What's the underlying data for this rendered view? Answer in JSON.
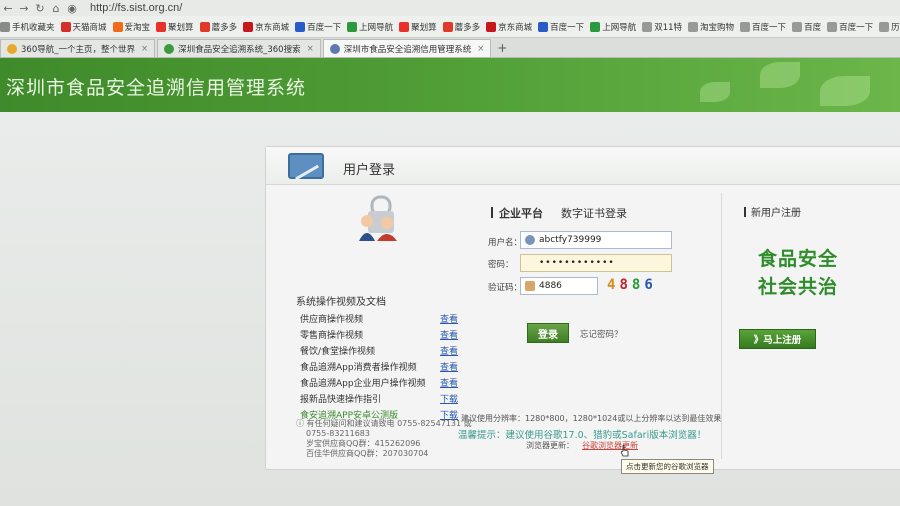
{
  "browser": {
    "url": "http://fs.sist.org.cn/",
    "bookmarks": [
      {
        "label": "手机收藏夹",
        "color": "#8a8a8a"
      },
      {
        "label": "天猫商城",
        "color": "#d6302b"
      },
      {
        "label": "爱淘宝",
        "color": "#f06a1a"
      },
      {
        "label": "聚划算",
        "color": "#e8312a"
      },
      {
        "label": "蘑多多",
        "color": "#e03a2a"
      },
      {
        "label": "京东商城",
        "color": "#c8161d"
      },
      {
        "label": "百度一下",
        "color": "#2a5cc8"
      },
      {
        "label": "上网导航",
        "color": "#2a9a3c"
      },
      {
        "label": "聚划算",
        "color": "#e8312a"
      },
      {
        "label": "蘑多多",
        "color": "#e03a2a"
      },
      {
        "label": "京东商城",
        "color": "#c8161d"
      },
      {
        "label": "百度一下",
        "color": "#2a5cc8"
      },
      {
        "label": "上网导航",
        "color": "#2a9a3c"
      },
      {
        "label": "双11特",
        "color": "#999999"
      },
      {
        "label": "淘宝购物",
        "color": "#999999"
      },
      {
        "label": "百度一下",
        "color": "#999999"
      },
      {
        "label": "百度",
        "color": "#999999"
      },
      {
        "label": "百度一下",
        "color": "#999999"
      },
      {
        "label": "历史解密",
        "color": "#999999"
      }
    ],
    "tabs": [
      {
        "label": "360导航_一个主页，整个世界",
        "active": false,
        "color": "#e8a92a"
      },
      {
        "label": "深圳食品安全追溯系统_360搜索",
        "active": false,
        "color": "#3a9a3c"
      },
      {
        "label": "深圳市食品安全追溯信用管理系统",
        "active": true,
        "color": "#5a7ab0"
      }
    ],
    "new_tab": "+"
  },
  "header": {
    "title": "深圳市食品安全追溯信用管理系统"
  },
  "panel": {
    "title": "用户登录",
    "left": {
      "section_title": "系统操作视频及文档",
      "items": [
        {
          "label": "供应商操作视频",
          "link": "查看",
          "green": false
        },
        {
          "label": "零售商操作视频",
          "link": "查看",
          "green": false
        },
        {
          "label": "餐饮/食堂操作视频",
          "link": "查看",
          "green": false
        },
        {
          "label": "食品追溯App消费者操作视频",
          "link": "查看",
          "green": false
        },
        {
          "label": "食品追溯App企业用户操作视频",
          "link": "查看",
          "green": false
        },
        {
          "label": "报新品快速操作指引",
          "link": "下载",
          "green": false
        },
        {
          "label": "食安追溯APP安卓公测版",
          "link": "下载",
          "green": true
        }
      ],
      "contact_lines": [
        "有任何疑问和建议请致电 0755-82547131 或",
        "0755-83211683",
        "岁宝供应商QQ群：415262096",
        "百佳华供应商QQ群：207030704"
      ]
    },
    "form": {
      "tab_active": "企业平台",
      "tab_other": "数字证书登录",
      "username_label": "用户名：",
      "username_value": "abctfy739999",
      "password_label": "密码：",
      "password_value": "••••••••••••",
      "captcha_label": "验证码：",
      "captcha_value": "4886",
      "captcha_image": "4886",
      "login_button": "登录",
      "forgot": "忘记密码？",
      "hint_resolution": "建议使用分辨率：1280*800，1280*1024或以上分辨率以达到最佳效果",
      "hint_browser": "温馨提示：建议使用谷歌17.0、猎豹或Safari版本浏览器！",
      "update_label": "浏览器更新：",
      "update_link": "谷歌浏览器更新",
      "tooltip": "点击更新您的谷歌浏览器"
    },
    "right": {
      "register_title": "新用户注册",
      "slogan_line1": "食品安全",
      "slogan_line2": "社会共治",
      "register_button": "》马上注册"
    }
  },
  "colors": {
    "banner_green": "#4d9a34",
    "slogan_green": "#2f8c2a",
    "link_blue": "#2a56b0"
  }
}
